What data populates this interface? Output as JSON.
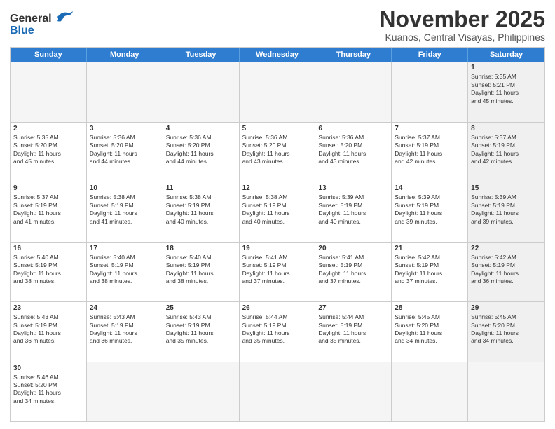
{
  "header": {
    "logo_general": "General",
    "logo_blue": "Blue",
    "title": "November 2025",
    "subtitle": "Kuanos, Central Visayas, Philippines"
  },
  "days": [
    "Sunday",
    "Monday",
    "Tuesday",
    "Wednesday",
    "Thursday",
    "Friday",
    "Saturday"
  ],
  "weeks": [
    [
      {
        "day": "",
        "info": ""
      },
      {
        "day": "",
        "info": ""
      },
      {
        "day": "",
        "info": ""
      },
      {
        "day": "",
        "info": ""
      },
      {
        "day": "",
        "info": ""
      },
      {
        "day": "",
        "info": ""
      },
      {
        "day": "1",
        "info": "Sunrise: 5:35 AM\nSunset: 5:21 PM\nDaylight: 11 hours\nand 45 minutes."
      }
    ],
    [
      {
        "day": "2",
        "info": "Sunrise: 5:35 AM\nSunset: 5:20 PM\nDaylight: 11 hours\nand 45 minutes."
      },
      {
        "day": "3",
        "info": "Sunrise: 5:36 AM\nSunset: 5:20 PM\nDaylight: 11 hours\nand 44 minutes."
      },
      {
        "day": "4",
        "info": "Sunrise: 5:36 AM\nSunset: 5:20 PM\nDaylight: 11 hours\nand 44 minutes."
      },
      {
        "day": "5",
        "info": "Sunrise: 5:36 AM\nSunset: 5:20 PM\nDaylight: 11 hours\nand 43 minutes."
      },
      {
        "day": "6",
        "info": "Sunrise: 5:36 AM\nSunset: 5:20 PM\nDaylight: 11 hours\nand 43 minutes."
      },
      {
        "day": "7",
        "info": "Sunrise: 5:37 AM\nSunset: 5:19 PM\nDaylight: 11 hours\nand 42 minutes."
      },
      {
        "day": "8",
        "info": "Sunrise: 5:37 AM\nSunset: 5:19 PM\nDaylight: 11 hours\nand 42 minutes."
      }
    ],
    [
      {
        "day": "9",
        "info": "Sunrise: 5:37 AM\nSunset: 5:19 PM\nDaylight: 11 hours\nand 41 minutes."
      },
      {
        "day": "10",
        "info": "Sunrise: 5:38 AM\nSunset: 5:19 PM\nDaylight: 11 hours\nand 41 minutes."
      },
      {
        "day": "11",
        "info": "Sunrise: 5:38 AM\nSunset: 5:19 PM\nDaylight: 11 hours\nand 40 minutes."
      },
      {
        "day": "12",
        "info": "Sunrise: 5:38 AM\nSunset: 5:19 PM\nDaylight: 11 hours\nand 40 minutes."
      },
      {
        "day": "13",
        "info": "Sunrise: 5:39 AM\nSunset: 5:19 PM\nDaylight: 11 hours\nand 40 minutes."
      },
      {
        "day": "14",
        "info": "Sunrise: 5:39 AM\nSunset: 5:19 PM\nDaylight: 11 hours\nand 39 minutes."
      },
      {
        "day": "15",
        "info": "Sunrise: 5:39 AM\nSunset: 5:19 PM\nDaylight: 11 hours\nand 39 minutes."
      }
    ],
    [
      {
        "day": "16",
        "info": "Sunrise: 5:40 AM\nSunset: 5:19 PM\nDaylight: 11 hours\nand 38 minutes."
      },
      {
        "day": "17",
        "info": "Sunrise: 5:40 AM\nSunset: 5:19 PM\nDaylight: 11 hours\nand 38 minutes."
      },
      {
        "day": "18",
        "info": "Sunrise: 5:40 AM\nSunset: 5:19 PM\nDaylight: 11 hours\nand 38 minutes."
      },
      {
        "day": "19",
        "info": "Sunrise: 5:41 AM\nSunset: 5:19 PM\nDaylight: 11 hours\nand 37 minutes."
      },
      {
        "day": "20",
        "info": "Sunrise: 5:41 AM\nSunset: 5:19 PM\nDaylight: 11 hours\nand 37 minutes."
      },
      {
        "day": "21",
        "info": "Sunrise: 5:42 AM\nSunset: 5:19 PM\nDaylight: 11 hours\nand 37 minutes."
      },
      {
        "day": "22",
        "info": "Sunrise: 5:42 AM\nSunset: 5:19 PM\nDaylight: 11 hours\nand 36 minutes."
      }
    ],
    [
      {
        "day": "23",
        "info": "Sunrise: 5:43 AM\nSunset: 5:19 PM\nDaylight: 11 hours\nand 36 minutes."
      },
      {
        "day": "24",
        "info": "Sunrise: 5:43 AM\nSunset: 5:19 PM\nDaylight: 11 hours\nand 36 minutes."
      },
      {
        "day": "25",
        "info": "Sunrise: 5:43 AM\nSunset: 5:19 PM\nDaylight: 11 hours\nand 35 minutes."
      },
      {
        "day": "26",
        "info": "Sunrise: 5:44 AM\nSunset: 5:19 PM\nDaylight: 11 hours\nand 35 minutes."
      },
      {
        "day": "27",
        "info": "Sunrise: 5:44 AM\nSunset: 5:19 PM\nDaylight: 11 hours\nand 35 minutes."
      },
      {
        "day": "28",
        "info": "Sunrise: 5:45 AM\nSunset: 5:20 PM\nDaylight: 11 hours\nand 34 minutes."
      },
      {
        "day": "29",
        "info": "Sunrise: 5:45 AM\nSunset: 5:20 PM\nDaylight: 11 hours\nand 34 minutes."
      }
    ],
    [
      {
        "day": "30",
        "info": "Sunrise: 5:46 AM\nSunset: 5:20 PM\nDaylight: 11 hours\nand 34 minutes."
      },
      {
        "day": "",
        "info": ""
      },
      {
        "day": "",
        "info": ""
      },
      {
        "day": "",
        "info": ""
      },
      {
        "day": "",
        "info": ""
      },
      {
        "day": "",
        "info": ""
      },
      {
        "day": "",
        "info": ""
      }
    ]
  ]
}
